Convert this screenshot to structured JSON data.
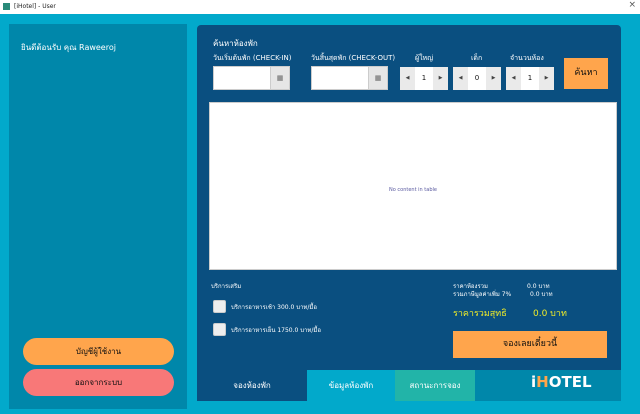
{
  "window": {
    "title": "[iHotel] - User",
    "close": "×"
  },
  "sidebar": {
    "welcome": "ยินดีต้อนรับ คุณ  Raweeroj",
    "account_button": "บัญชีผู้ใช้งาน",
    "logout_button": "ออกจากระบบ"
  },
  "search": {
    "title": "ค้นหาห้องพัก",
    "checkin_label": "วันเริ่มต้นพัก (CHECK-IN)",
    "checkout_label": "วันสิ้นสุดพัก (CHECK-OUT)",
    "checkin_value": "",
    "checkout_value": "",
    "adults_label": "ผู้ใหญ่",
    "adults": "1",
    "children_label": "เด็ก",
    "children": "0",
    "rooms_label": "จำนวนห้อง",
    "rooms": "1",
    "search_button": "ค้นหา",
    "calendar_icon": "▦",
    "left_arrow": "◀",
    "right_arrow": "▶"
  },
  "table": {
    "empty_text": "No content in table"
  },
  "extras": {
    "title": "บริการเสริม",
    "breakfast": "บริการอาหารเช้า 300.0 บาท/มื้อ",
    "dinner": "บริการอาหารเย็น 1750.0 บาท/มื้อ"
  },
  "summary": {
    "room_total_label": "ราคาห้องรวม",
    "room_total": "0.0 บาท",
    "vat_label": "รวมภาษีมูลค่าเพิ่ม 7%",
    "vat": "0.0 บาท",
    "net_label": "ราคารวมสุทธิ",
    "net": "0.0 บาท",
    "book_button": "จองเลยเดี๋ยวนี้"
  },
  "tabs": [
    {
      "label": "จองห้องพัก"
    },
    {
      "label": "ข้อมูลห้องพัก"
    },
    {
      "label": "สถานะการจอง"
    }
  ],
  "logo": {
    "i": "i",
    "h": "H",
    "rest": "OTEL"
  }
}
